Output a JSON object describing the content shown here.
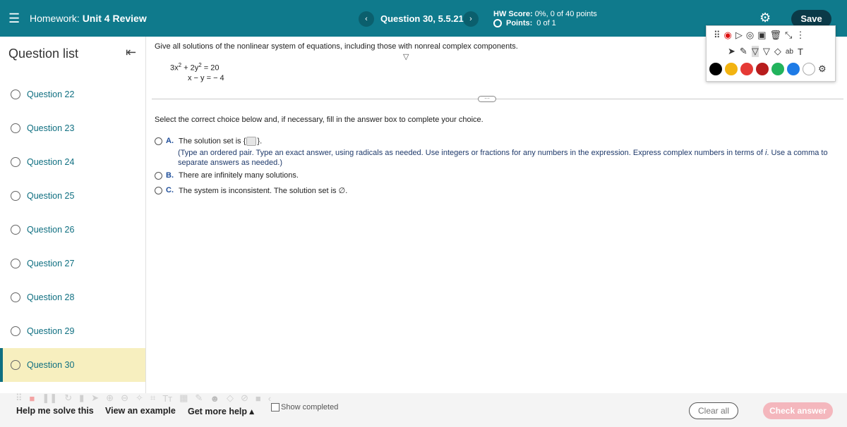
{
  "header": {
    "menu_icon": "hamburger-icon",
    "hw_prefix": "Homework:",
    "hw_name": "Unit 4 Review",
    "prev": "‹",
    "next": "›",
    "question_title": "Question 30, 5.5.21",
    "score_label": "HW Score:",
    "score_value": "0%, 0 of 40 points",
    "points_label": "Points:",
    "points_value": "0 of 1",
    "settings_icon": "gear-icon",
    "save_label": "Save"
  },
  "sidebar": {
    "title": "Question list",
    "collapse_icon": "collapse-left-icon",
    "items": [
      {
        "label": "Question 22"
      },
      {
        "label": "Question 23"
      },
      {
        "label": "Question 24"
      },
      {
        "label": "Question 25"
      },
      {
        "label": "Question 26"
      },
      {
        "label": "Question 27"
      },
      {
        "label": "Question 28"
      },
      {
        "label": "Question 29"
      },
      {
        "label": "Question 30"
      }
    ],
    "active_index": 8
  },
  "question": {
    "prompt": "Give all solutions of the nonlinear system of equations, including those with nonreal complex components.",
    "eq1_a": "3x",
    "eq1_b": "+ 2y",
    "eq1_c": "= 20",
    "eq1_exp": "2",
    "eq2": "x − y = − 4",
    "instruction": "Select the correct choice below and, if necessary, fill in the answer box to complete your choice.",
    "choices": [
      {
        "letter": "A.",
        "text_pre": "The solution set is {",
        "text_post": "}."
      },
      {
        "letter": "B.",
        "text": "There are infinitely many solutions."
      },
      {
        "letter": "C.",
        "text": "The system is inconsistent. The solution set is ∅."
      }
    ],
    "hint_pre": "(Type an ordered pair. Type an exact answer, using radicals as needed. Use integers or fractions for any numbers in the expression. Express complex numbers in terms of",
    "hint_i": "i",
    "hint_post": ". Use a comma to separate answers as needed.)"
  },
  "footer": {
    "help_solve": "Help me solve this",
    "view_example": "View an example",
    "get_more_help": "Get more help ▴",
    "show_completed": "Show completed",
    "clear_all": "Clear all",
    "check_answer": "Check answer"
  },
  "colors": {
    "header_bg": "#0f7a8c",
    "active_item_bg": "#f7efbf",
    "link": "#0f6f81",
    "check_btn_bg": "#f4b7bd",
    "palette": [
      "#000000",
      "#f2b311",
      "#e53935",
      "#b71c1c",
      "#22b35c",
      "#1e7be6",
      "#ffffff"
    ]
  }
}
